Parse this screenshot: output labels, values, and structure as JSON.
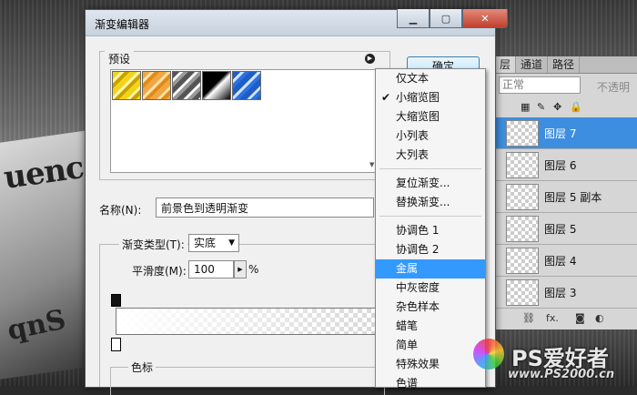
{
  "dialog": {
    "title": "渐变编辑器",
    "presets_label": "预设",
    "ok_label": "确定",
    "name_label": "名称(N):",
    "name_value": "前景色到透明渐变",
    "gradient_type_label": "渐变类型(T):",
    "gradient_type_value": "实底",
    "smoothness_label": "平滑度(M):",
    "smoothness_value": "100",
    "smoothness_unit": "%",
    "color_stops_label": "色标"
  },
  "menu": {
    "items": [
      {
        "label": "仅文本"
      },
      {
        "label": "小缩览图",
        "checked": true
      },
      {
        "label": "大缩览图"
      },
      {
        "label": "小列表"
      },
      {
        "label": "大列表"
      },
      {
        "label": "复位渐变..."
      },
      {
        "label": "替换渐变..."
      },
      {
        "label": "协调色 1"
      },
      {
        "label": "协调色 2"
      },
      {
        "label": "金属",
        "selected": true
      },
      {
        "label": "中灰密度"
      },
      {
        "label": "杂色样本"
      },
      {
        "label": "蜡笔"
      },
      {
        "label": "简单"
      },
      {
        "label": "特殊效果"
      },
      {
        "label": "色谱"
      }
    ],
    "check_mark": "✔"
  },
  "layers_panel": {
    "tabs": [
      "层",
      "通道",
      "路径"
    ],
    "blend_mode": "正常",
    "opacity_label": "不透明",
    "layers": [
      {
        "name": "图层 7",
        "active": true
      },
      {
        "name": "图层 6"
      },
      {
        "name": "图层 5 副本"
      },
      {
        "name": "图层 5"
      },
      {
        "name": "图层 4"
      },
      {
        "name": "图层 3"
      }
    ],
    "footer_fx": "fx."
  },
  "background": {
    "paper_text_1": "uenc",
    "paper_text_2": "qnS"
  },
  "watermark": {
    "text": "PS爱好者",
    "url": "www.PS2000.cn"
  },
  "colors": {
    "accent": "#3399ff",
    "layer_active": "#3d8ee0"
  }
}
